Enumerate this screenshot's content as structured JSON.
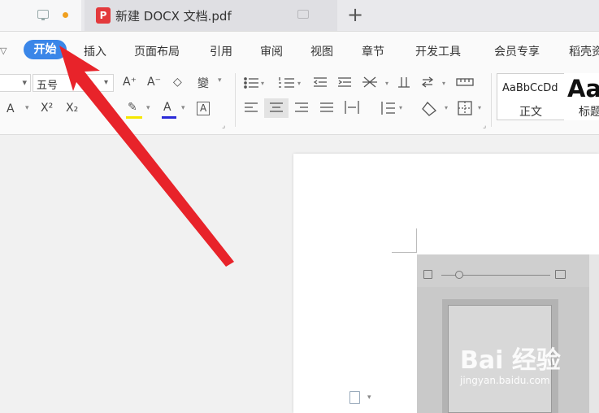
{
  "tabs": [
    {
      "label": ""
    },
    {
      "label": "新建 DOCX 文档.pdf",
      "icon": "pdf-icon"
    }
  ],
  "menu": {
    "active": "开始",
    "items": [
      "插入",
      "页面布局",
      "引用",
      "审阅",
      "视图",
      "章节",
      "开发工具",
      "会员专享",
      "稻壳资"
    ]
  },
  "ribbon": {
    "font_size": "五号",
    "font_name_value": "",
    "glyphs": {
      "grow_font": "A⁺",
      "shrink_font": "A⁻",
      "clear_format": "◇",
      "phonetic": "變",
      "strike": "A",
      "superscript": "X²",
      "subscript": "X₂",
      "highlight": "✎",
      "font_color": "A",
      "char_border": "A"
    },
    "styles": [
      {
        "preview": "AaBbCcDd",
        "name": "正文"
      },
      {
        "preview": "Aa",
        "name": "标题"
      }
    ]
  },
  "watermark": {
    "brand": "Bai 经验",
    "url": "jingyan.baidu.com"
  },
  "colors": {
    "accent": "#3a86e8",
    "arrow": "#e8232a",
    "pdf": "#e3393c",
    "dot": "#f0a020"
  }
}
